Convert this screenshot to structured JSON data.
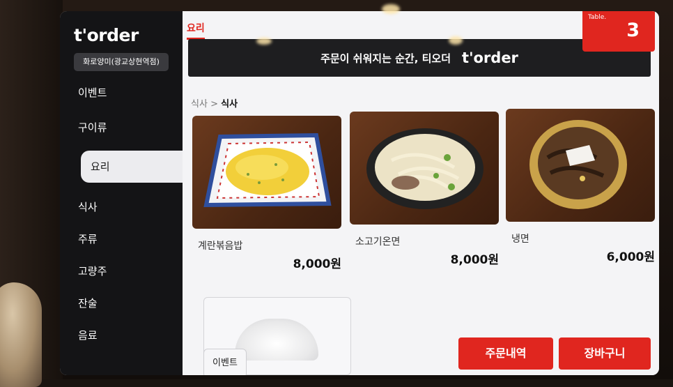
{
  "brand": {
    "logo": "t'order"
  },
  "store": {
    "name": "화로양미(광교상현역점)"
  },
  "sidebar": {
    "items": [
      {
        "label": "이벤트",
        "active": false
      },
      {
        "label": "구이류",
        "active": false
      },
      {
        "label": "요리",
        "active": true
      },
      {
        "label": "식사",
        "active": false
      },
      {
        "label": "주류",
        "active": false
      },
      {
        "label": "고량주",
        "active": false
      },
      {
        "label": "잔술",
        "active": false
      },
      {
        "label": "음료",
        "active": false
      }
    ]
  },
  "header": {
    "category_tab": "요리",
    "banner_text": "주문이 쉬워지는 순간, 티오더",
    "banner_logo": "t'order"
  },
  "table": {
    "label": "Table.",
    "number": "3"
  },
  "breadcrumb": {
    "parent": "식사",
    "separator": ">",
    "current": "식사"
  },
  "menu_items": [
    {
      "name": "계란볶음밥",
      "price": "8,000원"
    },
    {
      "name": "소고기온면",
      "price": "8,000원"
    },
    {
      "name": "냉면",
      "price": "6,000원"
    }
  ],
  "footer": {
    "event_label": "이벤트",
    "order_history_label": "주문내역",
    "cart_label": "장바구니"
  },
  "colors": {
    "accent": "#e0261f",
    "sidebar_bg": "#141416",
    "content_bg": "#f4f4f6"
  }
}
